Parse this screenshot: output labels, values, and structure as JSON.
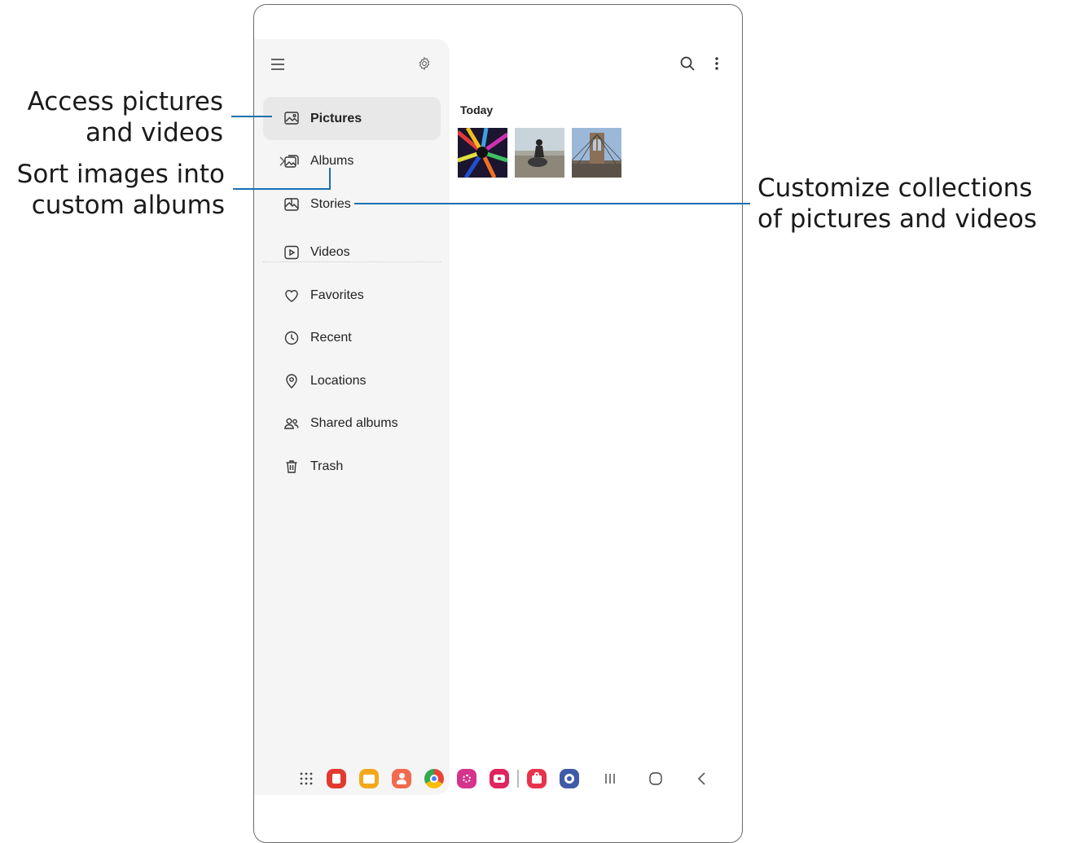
{
  "callouts": {
    "pictures_line1": "Access pictures",
    "pictures_line2": "and videos",
    "albums_line1": "Sort images into",
    "albums_line2": "custom albums",
    "stories_line1": "Customize collections",
    "stories_line2": "of pictures and videos"
  },
  "drawer": {
    "items": [
      {
        "label": "Pictures",
        "icon": "image-icon",
        "active": true
      },
      {
        "label": "Albums",
        "icon": "albums-icon",
        "expandable": true
      },
      {
        "label": "Stories",
        "icon": "stories-icon"
      },
      {
        "label": "Videos",
        "icon": "video-icon"
      },
      {
        "label": "Favorites",
        "icon": "heart-icon"
      },
      {
        "label": "Recent",
        "icon": "clock-icon"
      },
      {
        "label": "Locations",
        "icon": "location-pin-icon"
      },
      {
        "label": "Shared albums",
        "icon": "people-icon"
      },
      {
        "label": "Trash",
        "icon": "trash-icon"
      }
    ]
  },
  "content": {
    "section_title": "Today"
  },
  "accent_color": "#1a6fb0",
  "dock_apps": [
    "apps-grid-icon",
    "flipboard-app",
    "files-app",
    "contacts-app",
    "chrome-app",
    "blossom-app",
    "screen-recorder-app",
    "store-app",
    "settings-app"
  ]
}
